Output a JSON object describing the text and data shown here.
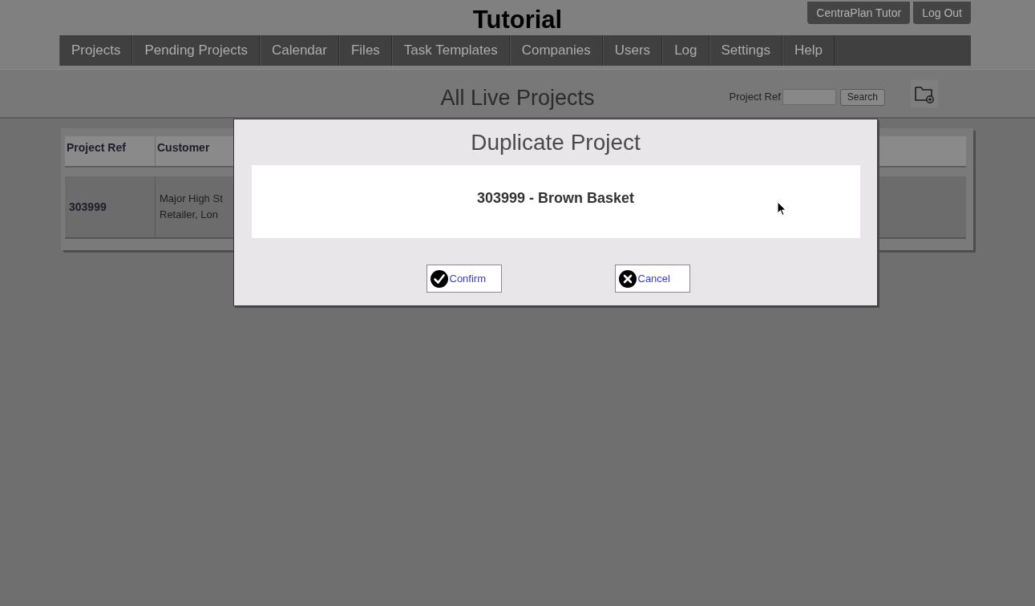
{
  "header": {
    "title": "Tutorial",
    "buttons": [
      "CentraPlan Tutor",
      "Log Out"
    ]
  },
  "nav": {
    "items": [
      "Projects",
      "Pending Projects",
      "Calendar",
      "Files",
      "Task Templates",
      "Companies",
      "Users",
      "Log",
      "Settings",
      "Help"
    ]
  },
  "page": {
    "title": "All Live Projects",
    "search": {
      "label": "Project Ref",
      "button": "Search"
    }
  },
  "table": {
    "columns": [
      "Project Ref",
      "Customer"
    ],
    "rows": [
      {
        "project_ref": "303999",
        "customer": [
          "Major High St",
          "Retailer, Lon"
        ]
      }
    ]
  },
  "dialog": {
    "title": "Duplicate Project",
    "message": "303999 - Brown Basket",
    "buttons": [
      {
        "kind": "confirm",
        "label": "Confirm"
      },
      {
        "kind": "cancel",
        "label": "Cancel"
      }
    ]
  }
}
